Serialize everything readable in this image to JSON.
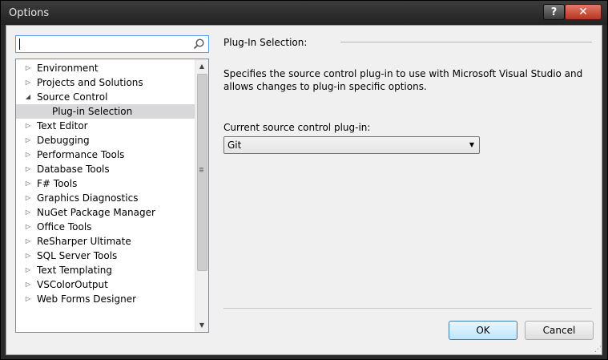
{
  "window": {
    "title": "Options",
    "help": "?",
    "close": "✕"
  },
  "search": {
    "placeholder": ""
  },
  "tree": {
    "items": [
      {
        "label": "Environment",
        "expander": "▷"
      },
      {
        "label": "Projects and Solutions",
        "expander": "▷"
      },
      {
        "label": "Source Control",
        "expander": "◢"
      },
      {
        "label": "Plug-in Selection",
        "expander": ""
      },
      {
        "label": "Text Editor",
        "expander": "▷"
      },
      {
        "label": "Debugging",
        "expander": "▷"
      },
      {
        "label": "Performance Tools",
        "expander": "▷"
      },
      {
        "label": "Database Tools",
        "expander": "▷"
      },
      {
        "label": "F# Tools",
        "expander": "▷"
      },
      {
        "label": "Graphics Diagnostics",
        "expander": "▷"
      },
      {
        "label": "NuGet Package Manager",
        "expander": "▷"
      },
      {
        "label": "Office Tools",
        "expander": "▷"
      },
      {
        "label": "ReSharper Ultimate",
        "expander": "▷"
      },
      {
        "label": "SQL Server Tools",
        "expander": "▷"
      },
      {
        "label": "Text Templating",
        "expander": "▷"
      },
      {
        "label": "VSColorOutput",
        "expander": "▷"
      },
      {
        "label": "Web Forms Designer",
        "expander": "▷"
      }
    ]
  },
  "panel": {
    "section_title": "Plug-In Selection:",
    "description": "Specifies the source control plug-in to use with Microsoft Visual Studio and allows changes to plug-in specific options.",
    "field_label": "Current source control plug-in:",
    "selected_plugin": "Git"
  },
  "buttons": {
    "ok": "OK",
    "cancel": "Cancel"
  },
  "colors": {
    "accent": "#569de5",
    "selection": "#d8d8da",
    "close": "#c7402c"
  }
}
